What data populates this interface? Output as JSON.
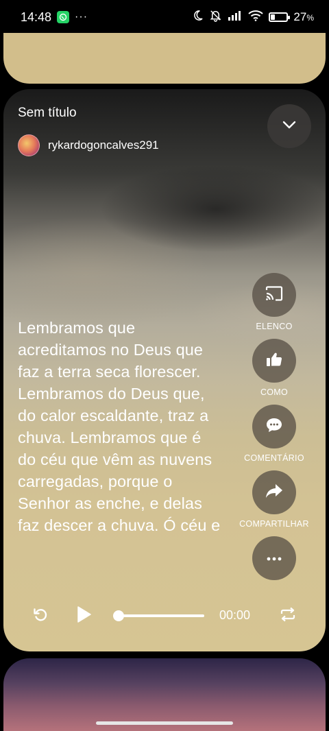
{
  "status_bar": {
    "time": "14:48",
    "more": "···",
    "battery": "27",
    "battery_unit": "%",
    "battery_level": 0.27
  },
  "post": {
    "title": "Sem título",
    "author": "rykardogoncalves291",
    "lyrics": "Lembramos que acreditamos no Deus que faz a terra seca florescer. Lembramos do Deus que, do calor escaldante, traz a chuva. Lembramos que é do céu que vêm as nuvens carregadas, porque o Senhor as enche, e delas faz descer a chuva. Ó céu e"
  },
  "actions": {
    "cast_label": "ELENCO",
    "like_label": "COMO",
    "comment_label": "COMENTÁRIO",
    "share_label": "COMPARTILHAR"
  },
  "player": {
    "time": "00:00",
    "progress": 0
  },
  "icons": {
    "whatsapp": "whatsapp-icon",
    "dnd": "moon-icon",
    "mute": "bell-off-icon",
    "signal": "signal-icon",
    "wifi": "wifi-icon",
    "battery": "battery-icon",
    "collapse": "chevron-down-icon",
    "cast": "cast-icon",
    "like": "thumbs-up-icon",
    "comment": "comment-icon",
    "share": "share-icon",
    "more": "more-icon",
    "replay": "replay-icon",
    "play": "play-icon",
    "repeat": "repeat-icon"
  },
  "colors": {
    "card_top": "#d2be8b",
    "accent_white": "#ffffff",
    "whatsapp_green": "#25d366"
  }
}
